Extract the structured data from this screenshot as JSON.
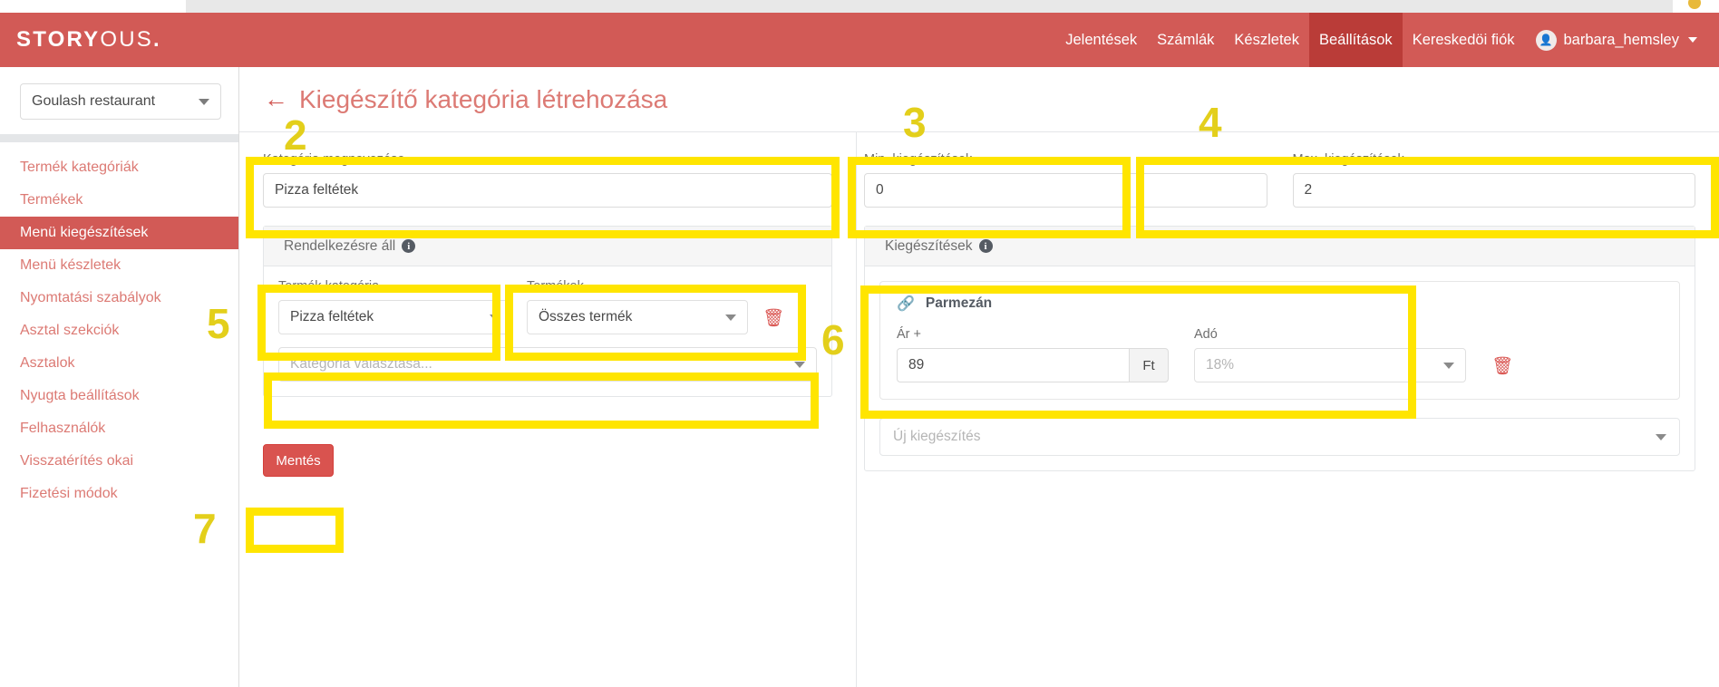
{
  "brand": {
    "logo_bold": "STORY",
    "logo_light": "OUS",
    "logo_dot": ".",
    "accent": "#d25a56",
    "accent_dark": "#ba3c38",
    "link_red": "#dc7a74",
    "danger": "#d9534f",
    "highlight": "#ffe500"
  },
  "topnav": {
    "items": [
      {
        "label": "Jelentések",
        "active": false
      },
      {
        "label": "Számlák",
        "active": false
      },
      {
        "label": "Készletek",
        "active": false
      },
      {
        "label": "Beállítások",
        "active": true
      },
      {
        "label": "Kereskedöi fiók",
        "active": false
      }
    ],
    "user": {
      "name": "barbara_hemsley",
      "avatar_icon": "user-icon"
    }
  },
  "sidebar": {
    "store_select": {
      "value": "Goulash restaurant",
      "icon": "chevron-down-icon"
    },
    "items": [
      {
        "label": "Termék kategóriák",
        "active": false
      },
      {
        "label": "Termékek",
        "active": false
      },
      {
        "label": "Menü kiegészítések",
        "active": true
      },
      {
        "label": "Menü készletek",
        "active": false
      },
      {
        "label": "Nyomtatási szabályok",
        "active": false
      },
      {
        "label": "Asztal szekciók",
        "active": false
      },
      {
        "label": "Asztalok",
        "active": false
      },
      {
        "label": "Nyugta beállítások",
        "active": false
      },
      {
        "label": "Felhasználók",
        "active": false
      },
      {
        "label": "Visszatérítés okai",
        "active": false
      },
      {
        "label": "Fizetési módok",
        "active": false
      }
    ]
  },
  "page": {
    "back_icon": "back-arrow-icon",
    "title": "Kiegészítő kategória létrehozása"
  },
  "form": {
    "category_name": {
      "label": "Kategória megnevezése",
      "value": "Pizza feltétek"
    },
    "min_addons": {
      "label": "Min. kiegészítések",
      "value": "0"
    },
    "max_addons": {
      "label": "Max. kiegészítések",
      "value": "2"
    }
  },
  "availability_panel": {
    "title": "Rendelkezésre áll",
    "info_icon": "info-icon",
    "product_category": {
      "label": "Termék kategória",
      "value": "Pizza feltétek",
      "icon": "chevron-down-icon"
    },
    "products": {
      "label": "Termékek",
      "value": "Összes termék",
      "icon": "chevron-down-icon"
    },
    "delete_icon": "trash-icon",
    "category_picker_placeholder": "Kategória választása...",
    "category_picker_icon": "chevron-down-icon"
  },
  "addons_panel": {
    "title": "Kiegészítések",
    "info_icon": "info-icon",
    "items": [
      {
        "link_icon": "link-icon",
        "name": "Parmezán",
        "price_label": "Ár +",
        "price_value": "89",
        "price_currency": "Ft",
        "tax_label": "Adó",
        "tax_value": "18%",
        "tax_icon": "chevron-down-icon",
        "delete_icon": "trash-icon"
      }
    ],
    "new_addon_placeholder": "Új kiegészítés",
    "new_addon_icon": "chevron-down-icon"
  },
  "actions": {
    "save_label": "Mentés"
  },
  "annotations": {
    "markers": [
      {
        "number": "2"
      },
      {
        "number": "3"
      },
      {
        "number": "4"
      },
      {
        "number": "5"
      },
      {
        "number": "6"
      },
      {
        "number": "7"
      }
    ]
  }
}
